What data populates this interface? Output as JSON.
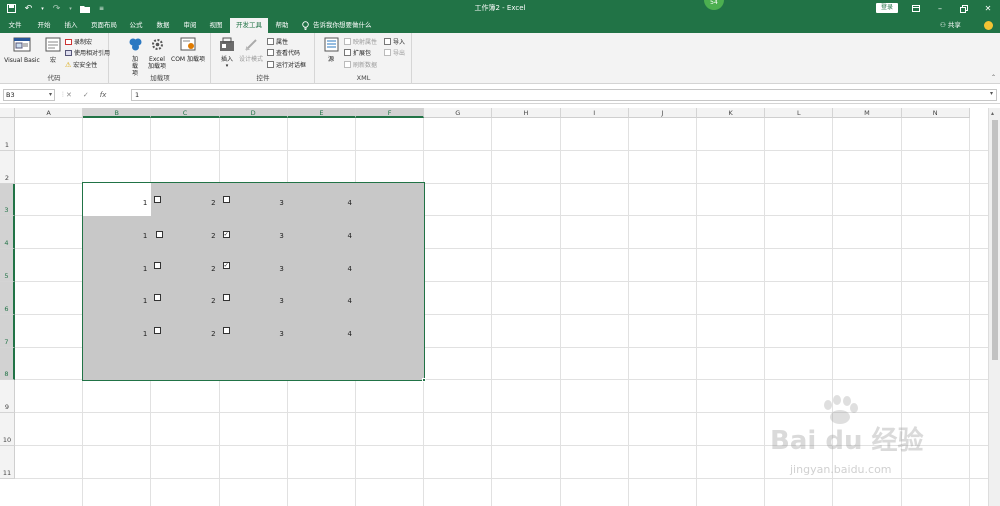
{
  "window": {
    "title": "工作簿2 - Excel",
    "badge": "54",
    "login_label": "登录"
  },
  "tabs": [
    "文件",
    "开始",
    "插入",
    "页面布局",
    "公式",
    "数据",
    "审阅",
    "视图",
    "开发工具",
    "帮助"
  ],
  "active_tab": "开发工具",
  "tellme": "告诉我你想要做什么",
  "share_label": "共享",
  "ribbon": {
    "code": {
      "label": "代码",
      "visual_basic": "Visual Basic",
      "macro": "宏",
      "record_macro": "录制宏",
      "relative_ref": "使用相对引用",
      "macro_security": "宏安全性"
    },
    "addins": {
      "label": "加载项",
      "addin": "加载项",
      "excel_addin": "Excel 加载项",
      "com_addin": "COM 加载项"
    },
    "controls": {
      "label": "控件",
      "insert": "插入",
      "design_mode": "设计模式",
      "properties": "属性",
      "view_code": "查看代码",
      "run_dialog": "运行对话框"
    },
    "xml": {
      "label": "XML",
      "source": "源",
      "map_properties": "映射属性",
      "expansion_pack": "扩展包",
      "refresh_data": "刷新数据",
      "import": "导入",
      "export": "导出"
    }
  },
  "formula_bar": {
    "name_box": "B3",
    "value": "1",
    "fx": "fx"
  },
  "columns": [
    "A",
    "B",
    "C",
    "D",
    "E",
    "F",
    "G",
    "H",
    "I",
    "J",
    "K",
    "L",
    "M",
    "N"
  ],
  "rows": [
    "1",
    "2",
    "3",
    "4",
    "5",
    "6",
    "7",
    "8",
    "9",
    "10",
    "11"
  ],
  "selection": {
    "range": "B3:F8",
    "active_cell": "B3"
  },
  "cells": [
    {
      "row": 3,
      "b": "1",
      "c": "2",
      "d": "3",
      "e": "4",
      "c_checked": false,
      "d_checked": false
    },
    {
      "row": 4,
      "b": "1",
      "c": "2",
      "d": "3",
      "e": "4",
      "c_checked": false,
      "d_checked": true
    },
    {
      "row": 5,
      "b": "1",
      "c": "2",
      "d": "3",
      "e": "4",
      "c_checked": false,
      "d_checked": true
    },
    {
      "row": 6,
      "b": "1",
      "c": "2",
      "d": "3",
      "e": "4",
      "c_checked": false,
      "d_checked": false
    },
    {
      "row": 7,
      "b": "1",
      "c": "2",
      "d": "3",
      "e": "4",
      "c_checked": false,
      "d_checked": false
    }
  ],
  "watermark": {
    "brand": "Bai du 经验",
    "url": "jingyan.baidu.com"
  },
  "colors": {
    "accent": "#217346",
    "selection": "#c8c8c8"
  }
}
